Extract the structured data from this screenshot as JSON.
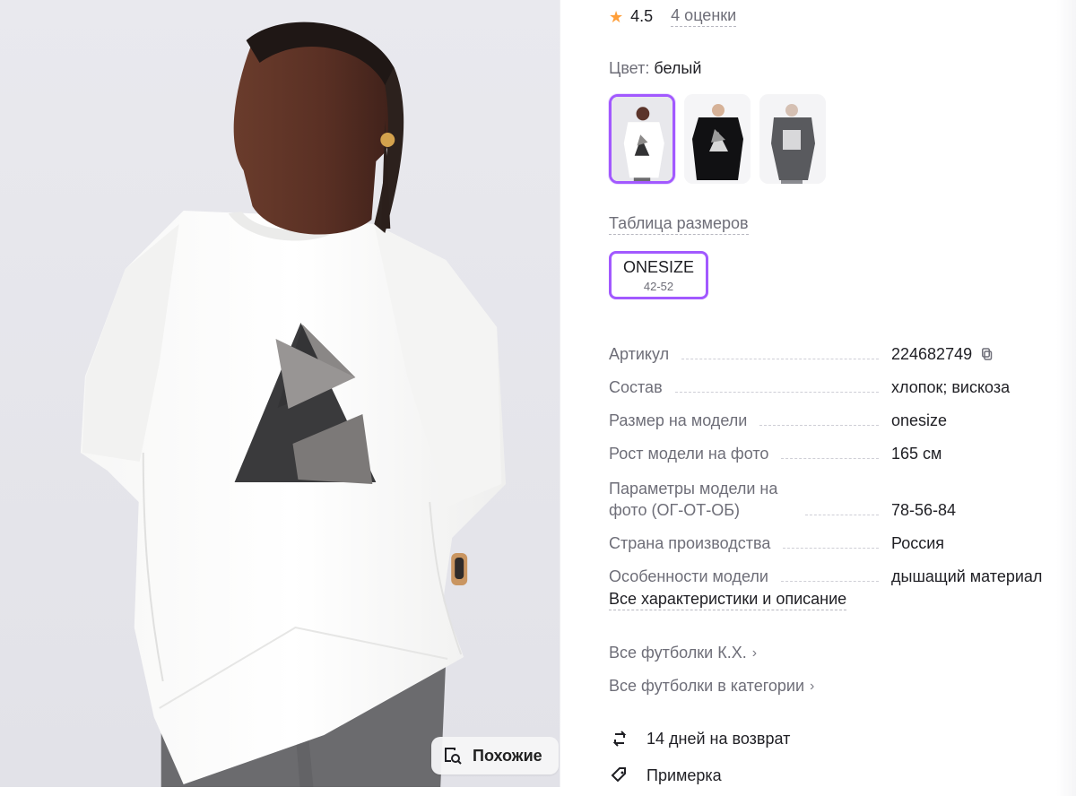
{
  "hero": {
    "similar_button_label": "Похожие",
    "icon": "search-similar-icon"
  },
  "rating": {
    "value": "4.5",
    "reviews_label": "4 оценки",
    "icon": "star-icon",
    "accent": "#ff9f3a"
  },
  "color": {
    "label": "Цвет:",
    "value": "белый",
    "swatches": [
      {
        "name": "white"
      },
      {
        "name": "black"
      },
      {
        "name": "grey"
      }
    ]
  },
  "size_table_label": "Таблица размеров",
  "size_option": {
    "main": "ONESIZE",
    "sub": "42-52",
    "selected_border": "#a259ff"
  },
  "specs": [
    {
      "label": "Артикул",
      "value": "224682749"
    },
    {
      "label": "Состав",
      "value": "хлопок; вискоза"
    },
    {
      "label": "Размер на модели",
      "value": "onesize"
    },
    {
      "label": "Рост модели на фото",
      "value": "165 см"
    },
    {
      "label": "Параметры модели на фото (ОГ-ОТ-ОБ)",
      "value": "78-56-84"
    },
    {
      "label": "Страна производства",
      "value": "Россия"
    },
    {
      "label": "Особенности модели",
      "value": "дышащий материал"
    }
  ],
  "all_specs_link": "Все характеристики и описание",
  "links": {
    "brand": "Все футболки К.Х.",
    "category": "Все футболки в категории"
  },
  "features": {
    "return": "14 дней на возврат",
    "tryon": "Примерка"
  },
  "icons": {
    "copy": "copy-icon",
    "return": "refresh-icon",
    "tryon": "tag-icon",
    "chevron": "chevron-right-icon"
  }
}
